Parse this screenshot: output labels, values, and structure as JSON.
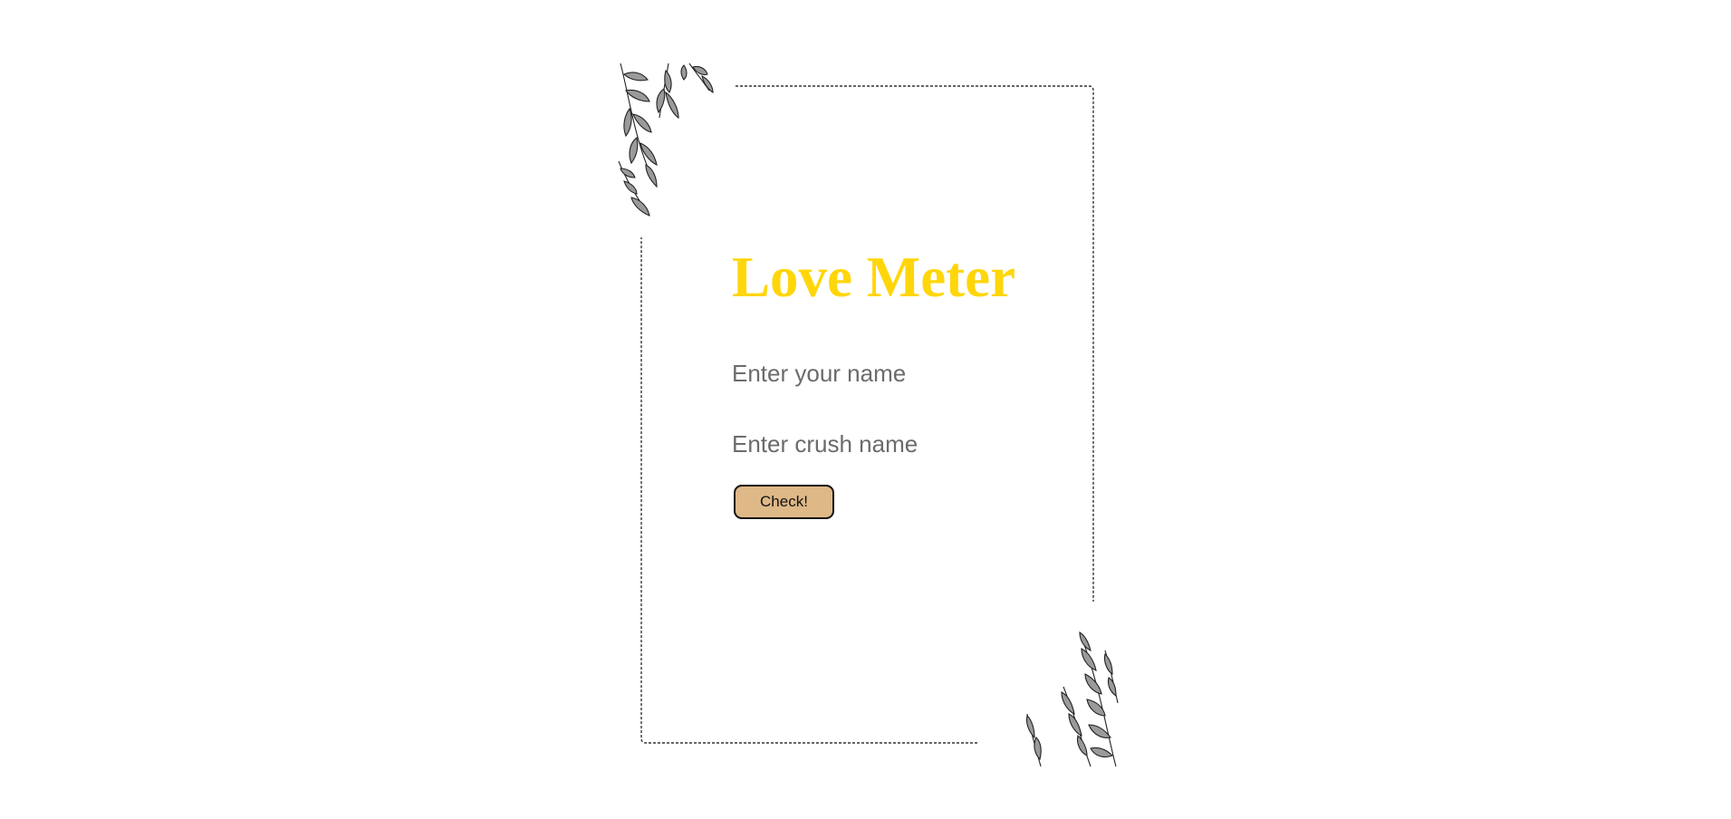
{
  "app": {
    "title": "Love Meter"
  },
  "form": {
    "your_name_placeholder": "Enter your name",
    "crush_name_placeholder": "Enter crush name",
    "check_label": "Check!"
  },
  "colors": {
    "title": "#ffd60a",
    "button_bg": "#deb887",
    "frame": "#333333",
    "leaf_stroke": "#222222",
    "leaf_fill": "#9a9a9a"
  },
  "decorations": {
    "top_left": "leaf-branch-icon",
    "bottom_right": "leaf-branch-icon"
  }
}
